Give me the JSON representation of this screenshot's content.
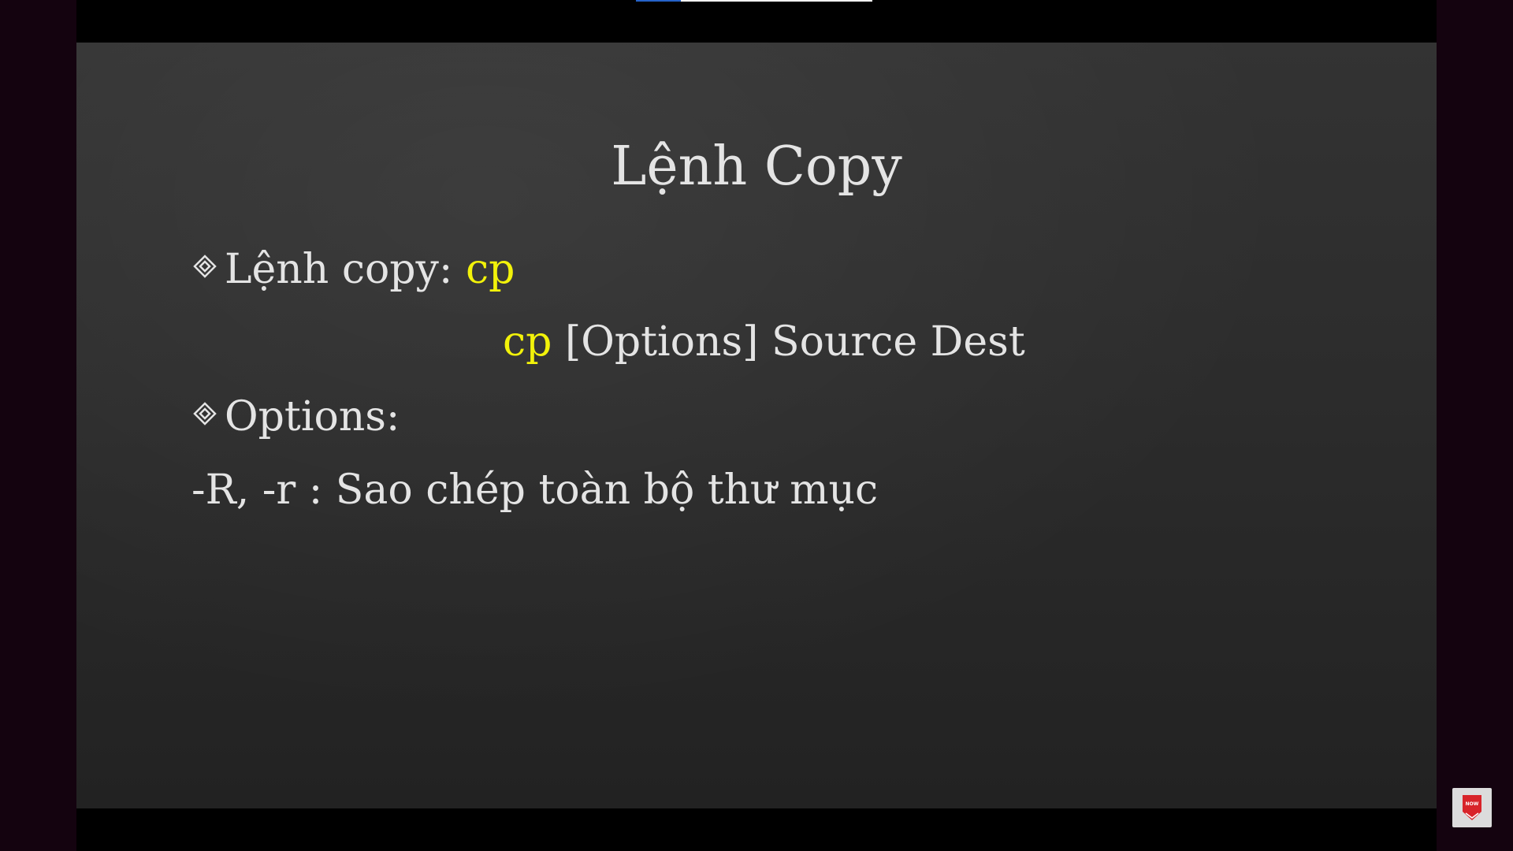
{
  "player": {
    "progress_fraction": 0.19,
    "colors": {
      "fill": "#2563c9",
      "track": "#ffffff",
      "outer_background": "#14030f"
    }
  },
  "slide": {
    "title": "Lệnh Copy",
    "bullet1": {
      "label": "Lệnh copy: ",
      "command": "cp"
    },
    "syntax": {
      "command": "cp",
      "rest": " [Options] Source Dest"
    },
    "bullet2": {
      "label": "Options:"
    },
    "option_line": "-R, -r : Sao chép toàn bộ thư mục",
    "colors": {
      "text": "#e4e4e4",
      "highlight": "#f2f20a",
      "background": "#2c2c2c"
    }
  },
  "badge": {
    "text": "NOW",
    "icon": "subscribe-badge-icon",
    "color": "#d8242a"
  }
}
